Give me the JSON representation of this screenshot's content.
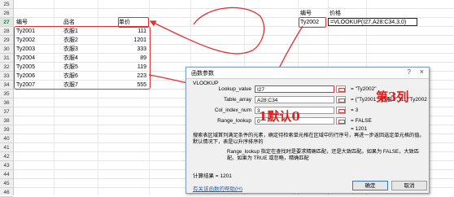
{
  "sheet": {
    "row_numbers": [
      "25",
      "26",
      "27",
      "28",
      "29",
      "30",
      "31",
      "32",
      "33",
      "34",
      "35",
      "36",
      "37",
      "38",
      "39",
      "40",
      "41",
      "42",
      "43",
      "44",
      "45",
      "46"
    ],
    "active_row": "27",
    "headers": {
      "id": "编号",
      "name": "品名",
      "price": "单价"
    },
    "rows": [
      {
        "id": "Ty2001",
        "name": "衣服1",
        "price": "111"
      },
      {
        "id": "Ty2002",
        "name": "衣服2",
        "price": "1201"
      },
      {
        "id": "Ty2003",
        "name": "衣服3",
        "price": "333"
      },
      {
        "id": "Ty2004",
        "name": "衣服4",
        "price": "89"
      },
      {
        "id": "Ty2005",
        "name": "衣服5",
        "price": "119"
      },
      {
        "id": "Ty2006",
        "name": "衣服6",
        "price": "223"
      },
      {
        "id": "Ty2007",
        "name": "衣服7",
        "price": "555"
      }
    ],
    "lookup": {
      "id_header": "编号",
      "price_header": "价格",
      "id_value": "Ty2002",
      "formula": "=VLOOKUP(I27,A28:C34,3,0)"
    }
  },
  "dialog": {
    "title": "函数参数",
    "function_name": "VLOOKUP",
    "fields": [
      {
        "label": "Lookup_value",
        "value": "I27",
        "result": "= \"Ty2002\""
      },
      {
        "label": "Table_array",
        "value": "A28:C34",
        "result": "= {\"Ty2001\",\"衣服1\",111;\"Ty2002\",\"衣"
      },
      {
        "label": "Col_index_num",
        "value": "3",
        "result": "= 3"
      },
      {
        "label": "Range_lookup",
        "value": "0",
        "result": "= FALSE"
      }
    ],
    "total_result": "= 1201",
    "description": "搜索表区域首列满足条件的元素，确定待检索单元格在区域中的行序号，再进一步返回选定单元格的值。默认情况下，表是以升序排序的",
    "param_name": "Range_lookup",
    "param_description": "指定在查找时是要求精确匹配，还是大致匹配。如果为 FALSE，大致匹配。如果为 TRUE 或忽略，精确匹配",
    "calc_label": "计算结果 = 1201",
    "help_link": "有关该函数的帮助(H)",
    "ok_label": "确定",
    "cancel_label": "取消",
    "help_icon": "?",
    "close_icon": "×"
  },
  "annotations": {
    "exact_match_note": "1默认0",
    "column_note": "第3列",
    "accent_color": "#e03030"
  }
}
